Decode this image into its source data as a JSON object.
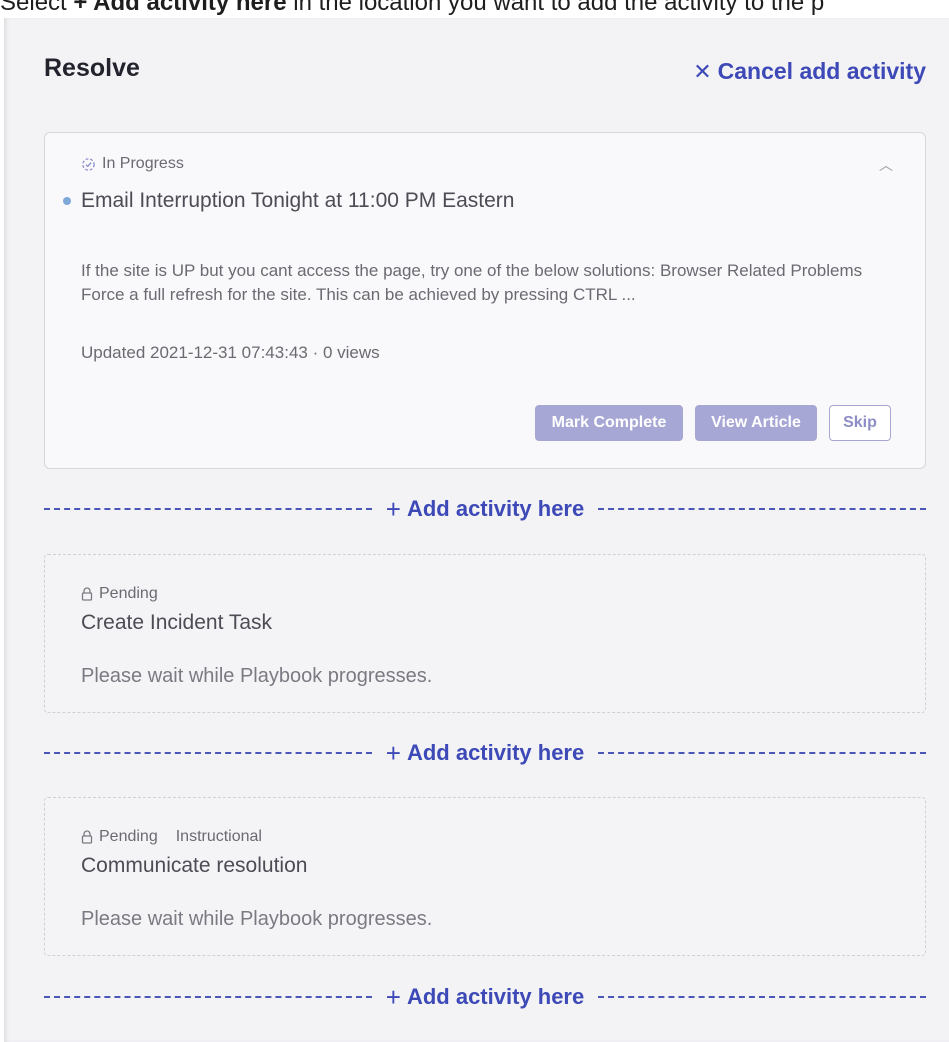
{
  "instruction": {
    "prefix": "Select ",
    "bold": "+ Add activity here",
    "suffix": " in the location you want to add the activity to the p"
  },
  "header": {
    "title": "Resolve",
    "cancel_icon": "close-icon",
    "cancel_label": "Cancel add activity"
  },
  "active_card": {
    "status_icon": "in-progress-icon",
    "status": "In Progress",
    "title": "Email Interruption Tonight at 11:00 PM Eastern",
    "description": "If the site is UP but you cant access the page, try one of the below solutions: Browser Related Problems Force a full refresh for the site. This can be achieved by pressing CTRL ...",
    "updated": "Updated 2021-12-31 07:43:43 · 0 views",
    "buttons": {
      "mark_complete": "Mark Complete",
      "view_article": "View Article",
      "skip": "Skip"
    }
  },
  "add_activity": {
    "label": "Add activity here",
    "plus": "+"
  },
  "pending_cards": [
    {
      "status_icon": "lock-icon",
      "status": "Pending",
      "tag": "",
      "title": "Create Incident Task",
      "message": "Please wait while Playbook progresses."
    },
    {
      "status_icon": "lock-icon",
      "status": "Pending",
      "tag": "Instructional",
      "title": "Communicate resolution",
      "message": "Please wait while Playbook progresses."
    }
  ],
  "colors": {
    "accent": "#3d49b6",
    "button_fill": "#a7a7d6",
    "panel_bg": "#f3f3f6",
    "progress_dot": "#7da8d8"
  }
}
